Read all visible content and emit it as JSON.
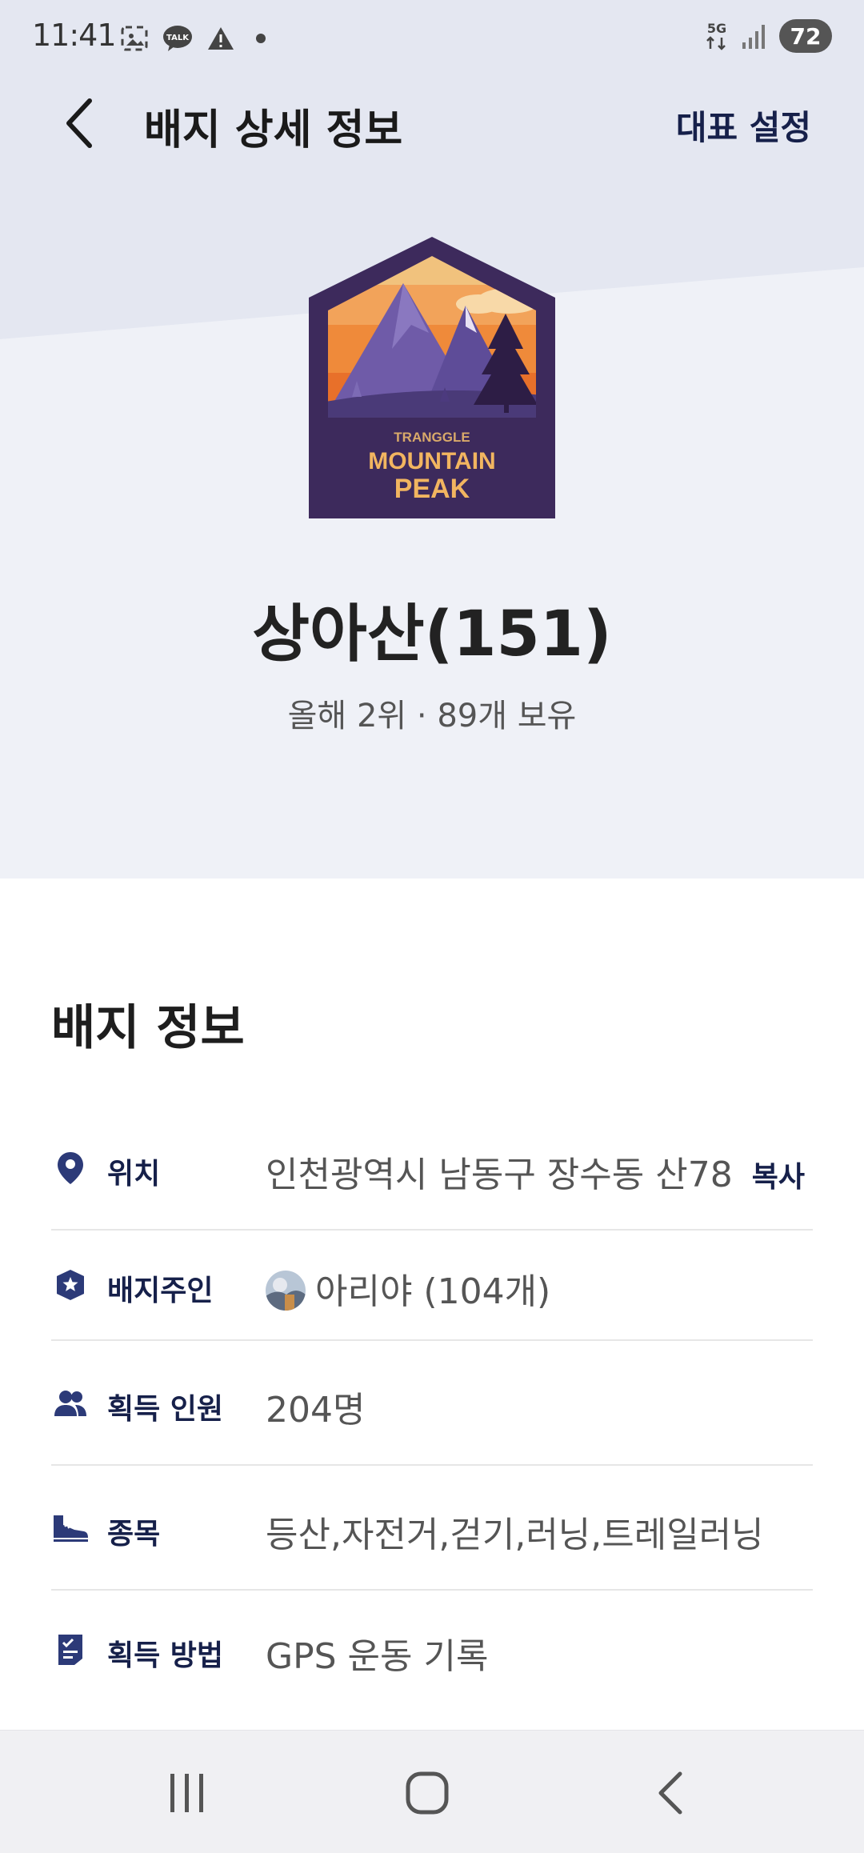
{
  "status_bar": {
    "time": "11:41",
    "battery": "72",
    "network": "5G",
    "left_icons": [
      "screenshot-icon",
      "kakaotalk-icon",
      "warning-icon",
      "dot-icon"
    ]
  },
  "app_bar": {
    "title": "배지 상세 정보",
    "action_label": "대표 설정"
  },
  "badge": {
    "brand": "TRANGGLE",
    "line1": "MOUNTAIN",
    "line2": "PEAK",
    "name": "상아산(151)",
    "sub": "올해 2위 · 89개 보유"
  },
  "info": {
    "title": "배지 정보",
    "rows": [
      {
        "icon": "location-pin-icon",
        "label": "위치",
        "value": "인천광역시 남동구 장수동 산78",
        "action": "복사"
      },
      {
        "icon": "badge-star-icon",
        "label": "배지주인",
        "value": "아리야 (104개)"
      },
      {
        "icon": "people-icon",
        "label": "획득 인원",
        "value": "204명"
      },
      {
        "icon": "shoe-icon",
        "label": "종목",
        "value": "등산,자전거,걷기,러닝,트레일러닝"
      },
      {
        "icon": "checklist-icon",
        "label": "획득 방법",
        "value": "GPS 운동 기록"
      }
    ]
  },
  "colors": {
    "hero_bg": "#edeff6",
    "accent_navy": "#16204a",
    "icon_blue": "#2c3a78",
    "badge_purple": "#3d2a5c",
    "badge_orange": "#f08a3c"
  },
  "nav_bar": [
    "recent-apps-icon",
    "home-icon",
    "back-icon"
  ]
}
